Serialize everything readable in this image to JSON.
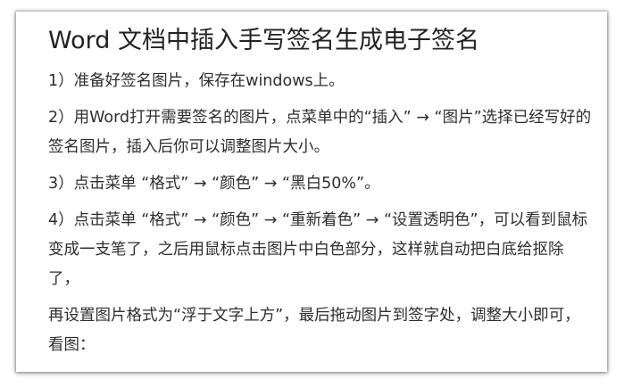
{
  "article": {
    "title": "Word 文档中插入手写签名生成电子签名",
    "paragraphs": [
      "1）准备好签名图片，保存在windows上。",
      "2）用Word打开需要签名的图片，点菜单中的“插入” → “图片”选择已经写好的签名图片，插入后你可以调整图片大小。",
      "3）点击菜单 “格式” → “颜色” → “黑白50%”。",
      "4）点击菜单 “格式” → “颜色” → “重新着色” → “设置透明色”，可以看到鼠标变成一支笔了，之后用鼠标点击图片中白色部分，这样就自动把白底给抠除了，",
      "再设置图片格式为“浮于文字上方”，最后拖动图片到签字处，调整大小即可，看图："
    ]
  }
}
